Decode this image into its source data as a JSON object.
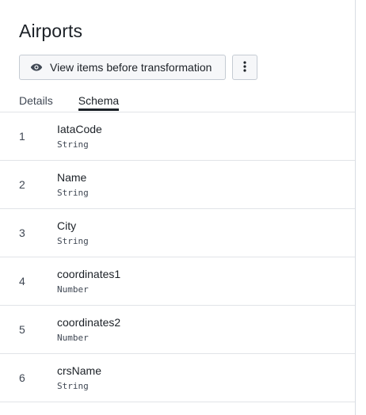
{
  "header": {
    "title": "Airports"
  },
  "toolbar": {
    "view_button_label": "View items before transformation",
    "view_button_icon": "eye-icon",
    "more_button_icon": "more-vertical-icon"
  },
  "tabs": [
    {
      "label": "Details",
      "active": false
    },
    {
      "label": "Schema",
      "active": true
    }
  ],
  "schema": {
    "rows": [
      {
        "index": "1",
        "name": "IataCode",
        "type": "String"
      },
      {
        "index": "2",
        "name": "Name",
        "type": "String"
      },
      {
        "index": "3",
        "name": "City",
        "type": "String"
      },
      {
        "index": "4",
        "name": "coordinates1",
        "type": "Number"
      },
      {
        "index": "5",
        "name": "coordinates2",
        "type": "Number"
      },
      {
        "index": "6",
        "name": "crsName",
        "type": "String"
      }
    ]
  },
  "colors": {
    "text": "#1c2127",
    "muted": "#404854",
    "divider": "#e1e4e8",
    "button_bg": "#f6f7f9"
  }
}
